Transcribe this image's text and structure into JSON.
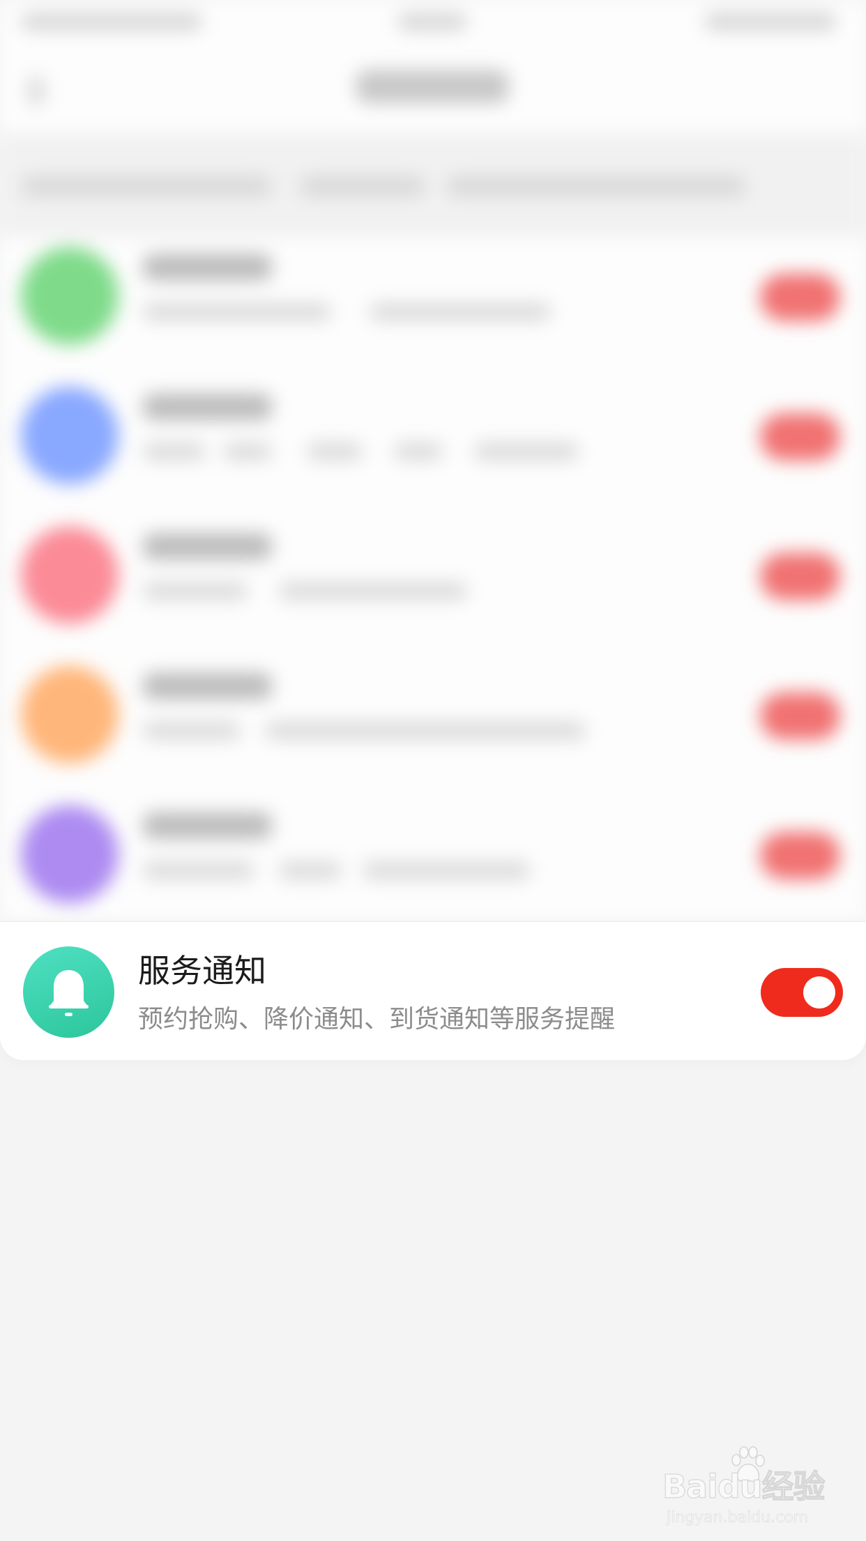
{
  "service_notification": {
    "title": "服务通知",
    "description": "预约抢购、降价通知、到货通知等服务提醒",
    "toggle_on": true,
    "icon": "bell-icon",
    "icon_color": "#34d3ac",
    "toggle_color": "#ef2b1d"
  },
  "blurred_rows": [
    {
      "icon_color": "#7fdb8a"
    },
    {
      "icon_color": "#89a8ff"
    },
    {
      "icon_color": "#fb8b97"
    },
    {
      "icon_color": "#ffb67a"
    },
    {
      "icon_color": "#ad8bf1"
    }
  ],
  "watermark": {
    "main": "Baidu经验",
    "url": "jingyan.baidu.com"
  }
}
